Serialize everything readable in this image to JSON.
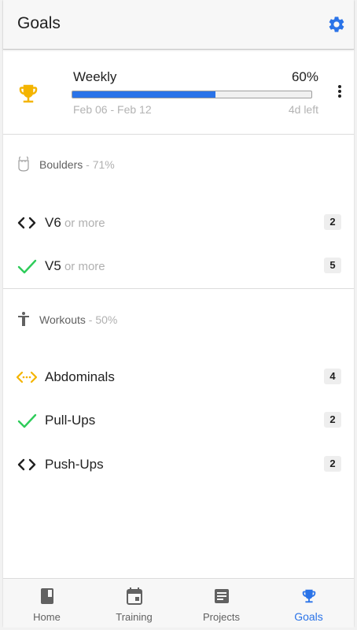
{
  "header": {
    "title": "Goals",
    "settings_icon": "gear-icon"
  },
  "weekly": {
    "label": "Weekly",
    "percent_text": "60%",
    "progress": 0.6,
    "dates": "Feb 06 - Feb 12",
    "time_left": "4d left",
    "icon": "trophy-icon"
  },
  "sections": [
    {
      "name": "Boulders",
      "pct": " - 71%",
      "icon": "chalk-bag-icon",
      "items": [
        {
          "label": "V6",
          "suffix": " or more",
          "count": "2",
          "icon": "code-brackets-icon"
        },
        {
          "label": "V5",
          "suffix": " or more",
          "count": "5",
          "icon": "checkmark-icon"
        }
      ]
    },
    {
      "name": "Workouts",
      "pct": " - 50%",
      "icon": "person-icon",
      "items": [
        {
          "label": "Abdominals",
          "count": "4",
          "icon": "dotted-brackets-icon"
        },
        {
          "label": "Pull-Ups",
          "count": "2",
          "icon": "checkmark-icon"
        },
        {
          "label": "Push-Ups",
          "count": "2",
          "icon": "code-brackets-icon"
        }
      ]
    }
  ],
  "nav": {
    "items": [
      {
        "label": "Home",
        "icon": "book-icon"
      },
      {
        "label": "Training",
        "icon": "calendar-icon"
      },
      {
        "label": "Projects",
        "icon": "list-icon"
      },
      {
        "label": "Goals",
        "icon": "trophy-icon"
      }
    ],
    "active": "Goals"
  },
  "colors": {
    "accent": "#2a73e8",
    "trophy": "#f4b400",
    "check": "#2ecc5a"
  }
}
